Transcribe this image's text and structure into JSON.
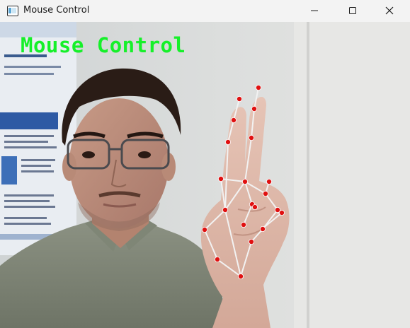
{
  "window": {
    "title": "Mouse Control",
    "icon": "app-window-icon",
    "controls": [
      "minimize-icon",
      "maximize-icon",
      "close-icon"
    ]
  },
  "overlay": {
    "label": "Mouse Control",
    "color": "#16f02a"
  },
  "hand_tracking": {
    "landmark_color": "#e01010",
    "connection_color": "#f2f2f2",
    "landmark_count": 21
  }
}
